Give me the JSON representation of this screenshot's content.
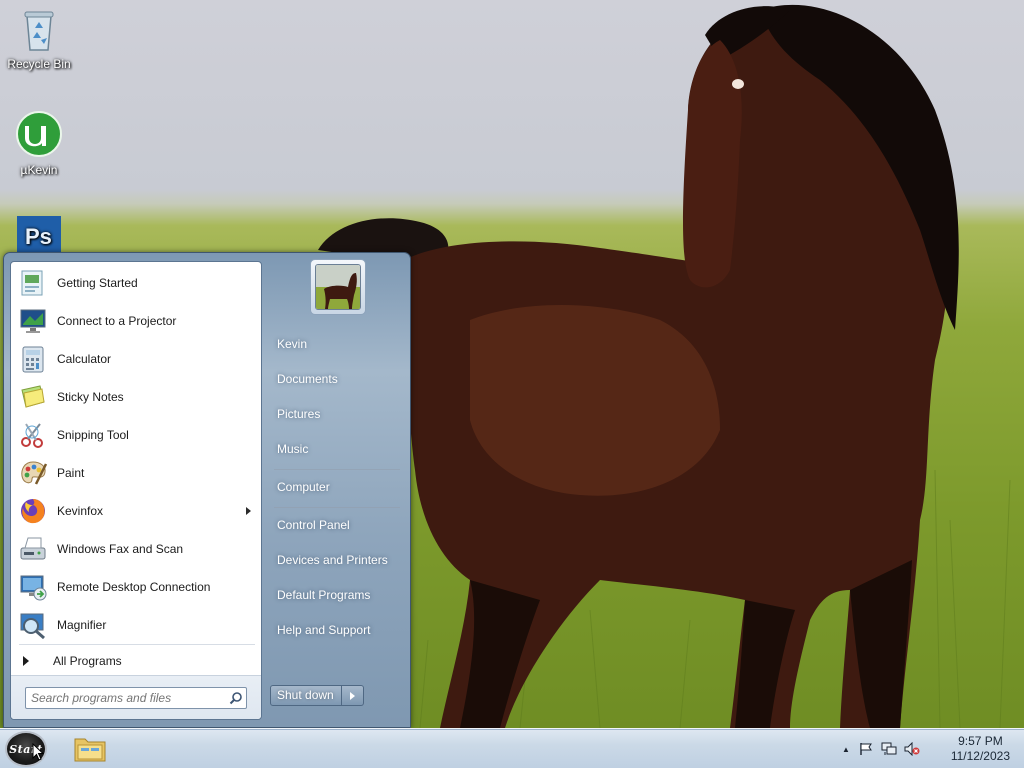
{
  "desktop": {
    "icons": [
      {
        "name": "recycle-bin",
        "label": "Recycle Bin",
        "icon": "recycle-bin-icon"
      },
      {
        "name": "utorrent",
        "label": "µKevin",
        "icon": "utorrent-icon"
      },
      {
        "name": "photoshop",
        "label": "",
        "icon": "photoshop-icon"
      }
    ]
  },
  "start_menu": {
    "programs": [
      {
        "label": "Getting Started",
        "icon": "getting-started-icon"
      },
      {
        "label": "Connect to a Projector",
        "icon": "projector-icon"
      },
      {
        "label": "Calculator",
        "icon": "calculator-icon"
      },
      {
        "label": "Sticky Notes",
        "icon": "sticky-notes-icon"
      },
      {
        "label": "Snipping Tool",
        "icon": "scissors-icon"
      },
      {
        "label": "Paint",
        "icon": "paint-palette-icon"
      },
      {
        "label": "Kevinfox",
        "icon": "firefox-icon",
        "has_submenu": true
      },
      {
        "label": "Windows Fax and Scan",
        "icon": "fax-icon"
      },
      {
        "label": "Remote Desktop Connection",
        "icon": "remote-desktop-icon"
      },
      {
        "label": "Magnifier",
        "icon": "magnifier-icon"
      }
    ],
    "all_programs": "All Programs",
    "search_placeholder": "Search programs and files",
    "right_items": [
      "Kevin",
      "Documents",
      "Pictures",
      "Music",
      "Computer",
      "Control Panel",
      "Devices and Printers",
      "Default Programs",
      "Help and Support"
    ],
    "shutdown_label": "Shut down"
  },
  "taskbar": {
    "start_label": "Start",
    "pinned": [
      {
        "label": "Windows Explorer",
        "icon": "folder-icon"
      }
    ],
    "tray_icons": [
      "show-hidden-icons-arrow",
      "action-center-flag-icon",
      "network-icon",
      "volume-muted-icon"
    ],
    "clock_time": "9:57 PM",
    "clock_date": "11/12/2023"
  }
}
